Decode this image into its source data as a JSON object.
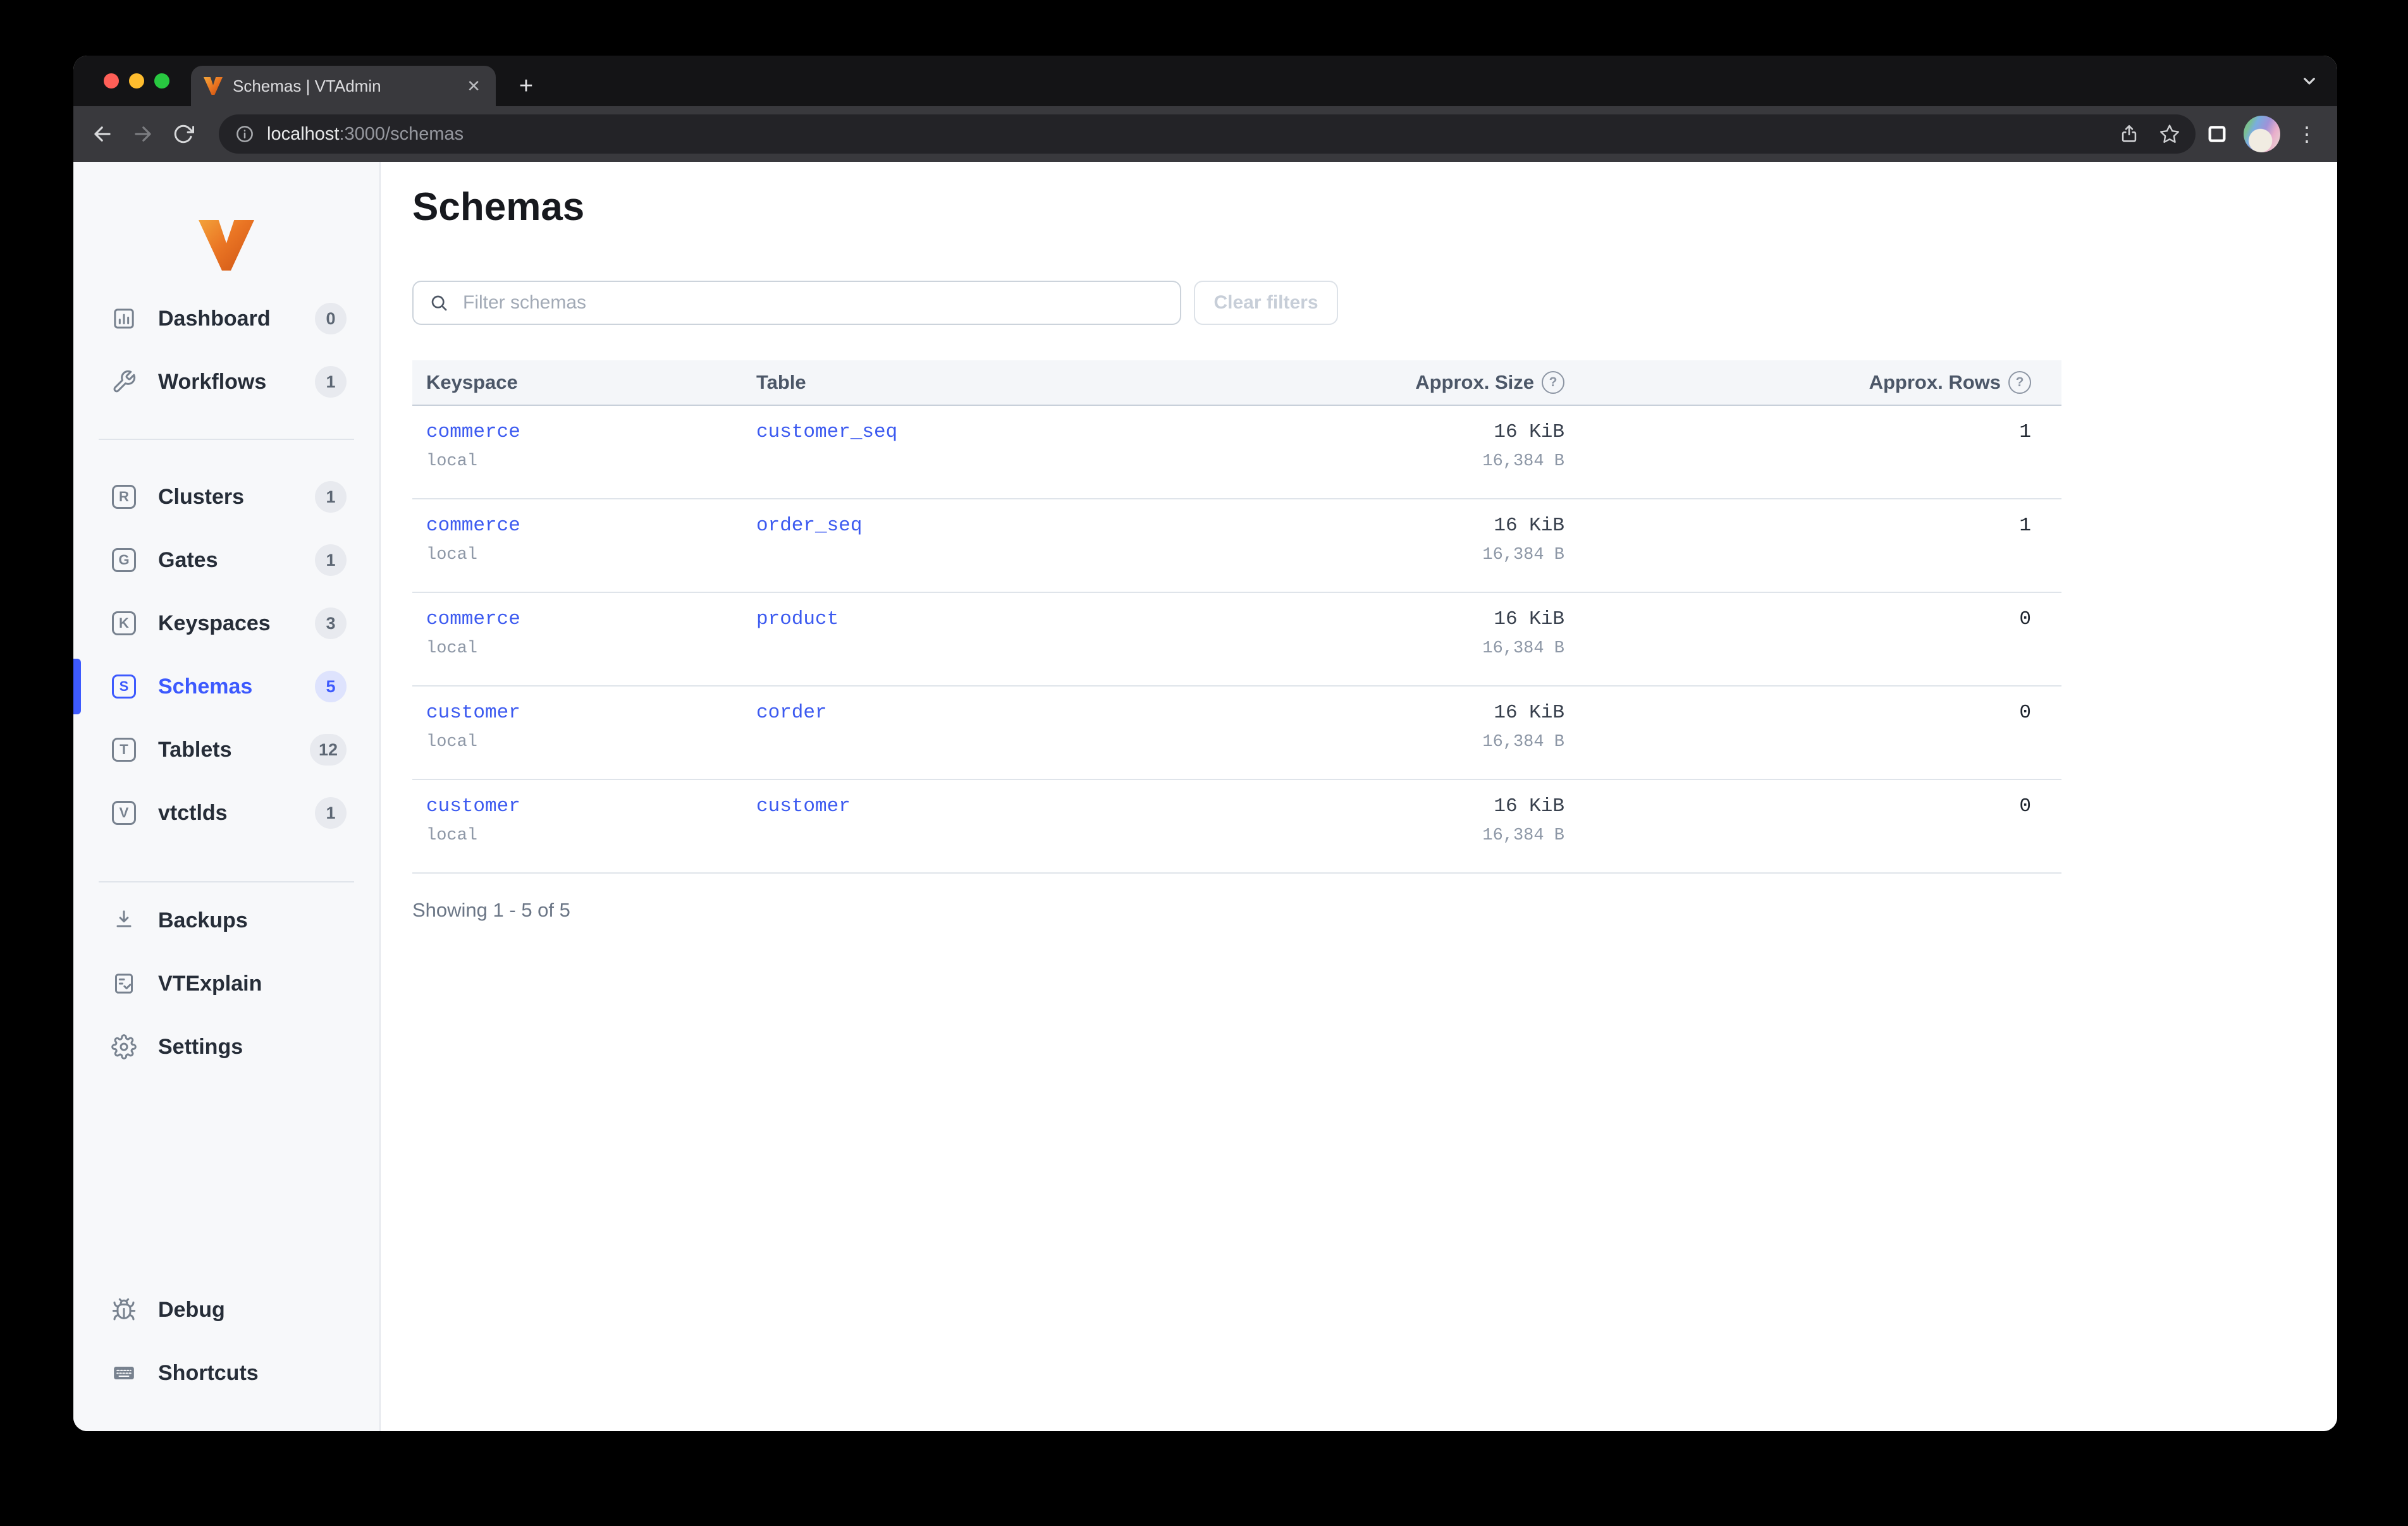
{
  "browser": {
    "tab_title": "Schemas | VTAdmin",
    "close_glyph": "✕",
    "newtab_glyph": "+",
    "dots_glyph": "⋮",
    "url_host": "localhost",
    "url_rest": ":3000/schemas"
  },
  "sidebar": {
    "top": [
      {
        "label": "Dashboard",
        "badge": "0"
      },
      {
        "label": "Workflows",
        "badge": "1"
      }
    ],
    "resources": [
      {
        "label": "Clusters",
        "letter": "R",
        "badge": "1"
      },
      {
        "label": "Gates",
        "letter": "G",
        "badge": "1"
      },
      {
        "label": "Keyspaces",
        "letter": "K",
        "badge": "3"
      },
      {
        "label": "Schemas",
        "letter": "S",
        "badge": "5",
        "active": true
      },
      {
        "label": "Tablets",
        "letter": "T",
        "badge": "12"
      },
      {
        "label": "vtctlds",
        "letter": "V",
        "badge": "1"
      }
    ],
    "tools": [
      {
        "label": "Backups"
      },
      {
        "label": "VTExplain"
      },
      {
        "label": "Settings"
      }
    ],
    "bottom": [
      {
        "label": "Debug"
      },
      {
        "label": "Shortcuts"
      }
    ]
  },
  "main": {
    "title": "Schemas",
    "filter_placeholder": "Filter schemas",
    "clear_filters_label": "Clear filters",
    "help_glyph": "?",
    "table": {
      "headers": [
        "Keyspace",
        "Table",
        "Approx. Size",
        "Approx. Rows"
      ],
      "rows": [
        {
          "keyspace": "commerce",
          "cluster": "local",
          "table": "customer_seq",
          "size": "16 KiB",
          "size_bytes": "16,384 B",
          "rows": "1"
        },
        {
          "keyspace": "commerce",
          "cluster": "local",
          "table": "order_seq",
          "size": "16 KiB",
          "size_bytes": "16,384 B",
          "rows": "1"
        },
        {
          "keyspace": "commerce",
          "cluster": "local",
          "table": "product",
          "size": "16 KiB",
          "size_bytes": "16,384 B",
          "rows": "0"
        },
        {
          "keyspace": "customer",
          "cluster": "local",
          "table": "corder",
          "size": "16 KiB",
          "size_bytes": "16,384 B",
          "rows": "0"
        },
        {
          "keyspace": "customer",
          "cluster": "local",
          "table": "customer",
          "size": "16 KiB",
          "size_bytes": "16,384 B",
          "rows": "0"
        }
      ]
    },
    "showing": "Showing 1 - 5 of 5"
  },
  "colors": {
    "accent_blue": "#3d5afe",
    "link_blue": "#3c5af0",
    "sidebar_bg": "#f7f8fa",
    "table_header_bg": "#f4f6f9",
    "logo_orange": "#ea7524"
  }
}
